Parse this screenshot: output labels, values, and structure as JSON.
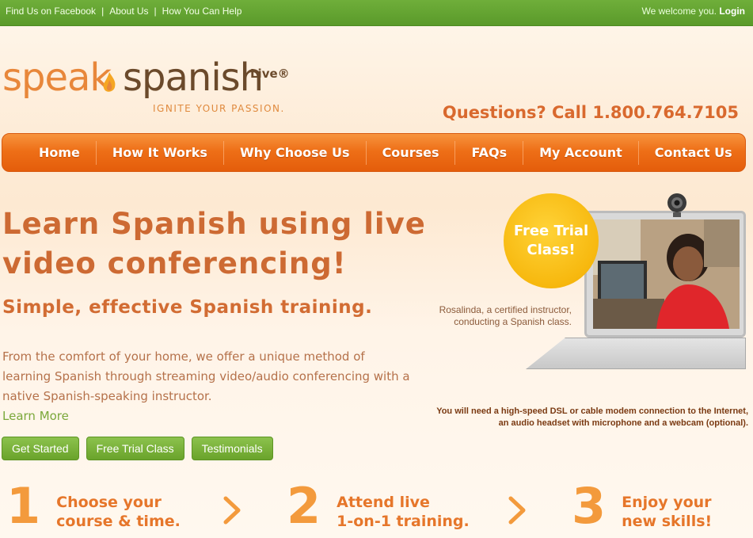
{
  "topbar": {
    "links": [
      "Find Us on Facebook",
      "About Us",
      "How You Can Help"
    ],
    "separator": "|",
    "welcome_text": "We welcome you.",
    "login_label": "Login"
  },
  "logo": {
    "word1": "speak",
    "word2": "spanish",
    "live": "Live®",
    "tagline": "IGNITE YOUR PASSION."
  },
  "phone": "Questions? Call 1.800.764.7105",
  "nav": {
    "items": [
      "Home",
      "How It Works",
      "Why Choose Us",
      "Courses",
      "FAQs",
      "My Account",
      "Contact Us"
    ]
  },
  "hero": {
    "title": "Learn Spanish using live video conferencing!",
    "subtitle": "Simple, effective Spanish training.",
    "body": "From the comfort of your home, we offer a unique method of learning Spanish through streaming video/audio conferencing with a native Spanish-speaking instructor.",
    "learn_more": "Learn More",
    "buttons": [
      "Get Started",
      "Free Trial Class",
      "Testimonials"
    ]
  },
  "visual": {
    "trial_badge_line1": "Free Trial",
    "trial_badge_line2": "Class!",
    "caption": "Rosalinda, a certified instructor, conducting a Spanish class.",
    "requirements": "You will need a high-speed DSL or cable modem connection to the Internet, an audio headset with microphone and a webcam (optional)."
  },
  "steps": [
    {
      "number": "1",
      "line1": "Choose your",
      "line2": "course & time."
    },
    {
      "number": "2",
      "line1": "Attend live",
      "line2": "1-on-1 training."
    },
    {
      "number": "3",
      "line1": "Enjoy your",
      "line2": "new skills!"
    }
  ],
  "colors": {
    "accent_orange": "#ee6f17",
    "green": "#6aa32b",
    "badge_yellow": "#f7b80e"
  }
}
